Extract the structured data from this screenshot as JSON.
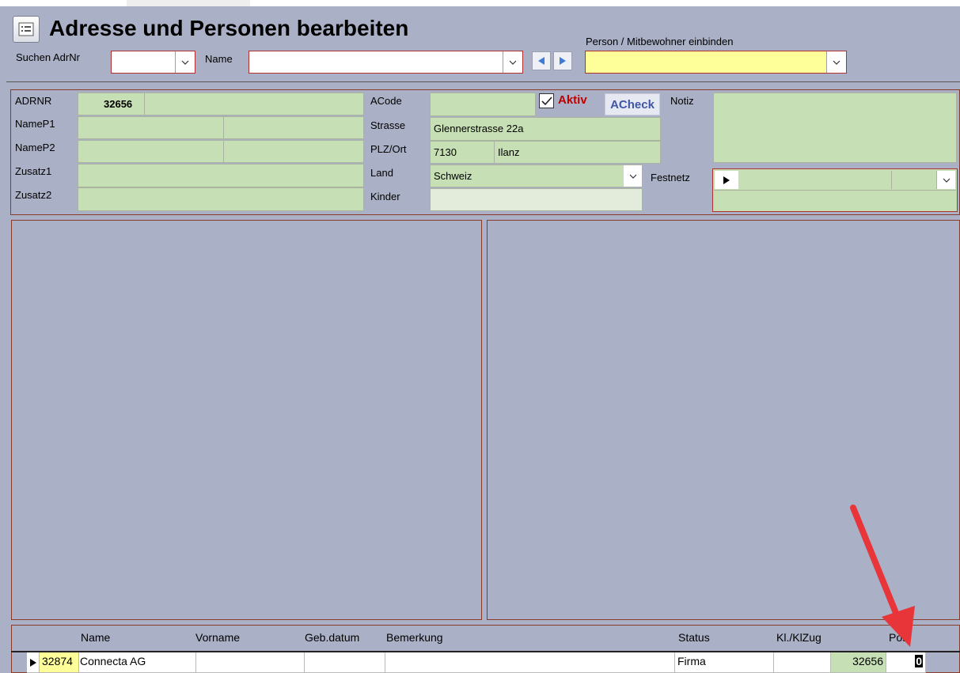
{
  "window": {
    "title": "Adresse und Personen bearbeiten"
  },
  "search": {
    "adrnr_label": "Suchen AdrNr",
    "adrnr_value": "",
    "name_label": "Name",
    "name_value": "",
    "person_label": "Person / Mitbewohner einbinden",
    "person_value": ""
  },
  "form": {
    "adrnr": {
      "label": "ADRNR",
      "value": "32656"
    },
    "namep1": {
      "label": "NameP1",
      "value1": "",
      "value2": ""
    },
    "namep2": {
      "label": "NameP2",
      "value1": "",
      "value2": ""
    },
    "zusatz1": {
      "label": "Zusatz1",
      "value": ""
    },
    "zusatz2": {
      "label": "Zusatz2",
      "value": ""
    },
    "acode": {
      "label": "ACode",
      "value": ""
    },
    "aktiv": {
      "label": "Aktiv",
      "checked": true
    },
    "acheck_label": "ACheck",
    "strasse": {
      "label": "Strasse",
      "value": "Glennerstrasse 22a"
    },
    "plz_ort": {
      "label": "PLZ/Ort",
      "plz": "7130",
      "ort": "Ilanz"
    },
    "land": {
      "label": "Land",
      "value": "Schweiz"
    },
    "kinder": {
      "label": "Kinder",
      "value": ""
    },
    "notiz": {
      "label": "Notiz",
      "value": ""
    },
    "festnetz": {
      "label": "Festnetz",
      "value": ""
    }
  },
  "grid": {
    "headers": {
      "name": "Name",
      "vorname": "Vorname",
      "gebdatum": "Geb.datum",
      "bemerkung": "Bemerkung",
      "status": "Status",
      "klzug": "Kl./KlZug",
      "pos": "Pos"
    },
    "rows": [
      {
        "id": "32874",
        "name": "Connecta AG",
        "vorname": "",
        "gebdatum": "",
        "bemerkung": "",
        "status": "Firma",
        "klzug": "",
        "adrnr": "32656",
        "pos": "0"
      }
    ]
  },
  "colors": {
    "background": "#aab0c5",
    "field_green": "#c6dfb4",
    "highlight_yellow": "#ffff99",
    "border_red": "#b03030",
    "annotation_arrow": "#e8353a",
    "aktiv_red": "#c00000",
    "acheck_blue": "#3f55a8"
  }
}
